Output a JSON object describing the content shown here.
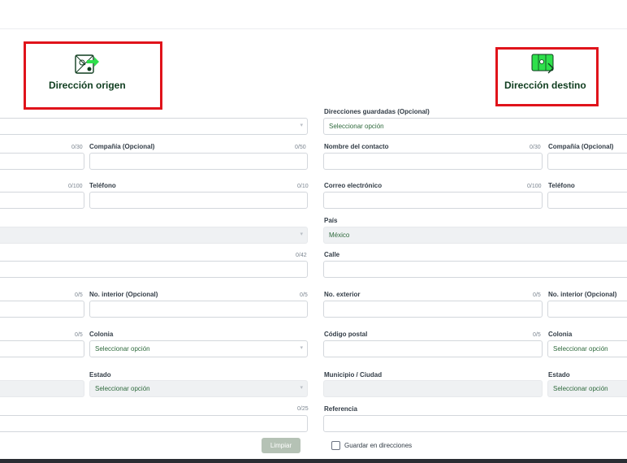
{
  "origin": {
    "title": "Dirección origen",
    "icon": "map-route-icon",
    "labels": {
      "company": "Compañía (Opcional)",
      "phone": "Teléfono",
      "interior": "No. interior (Opcional)",
      "colonia": "Colonia",
      "estado": "Estado"
    },
    "counters": {
      "name": "0/30",
      "company": "0/50",
      "email": "0/100",
      "phone": "0/10",
      "street": "0/42",
      "exterior": "0/5",
      "interior": "0/5",
      "postal": "0/5",
      "reference": "0/25"
    },
    "placeholders": {
      "colonia": "Seleccionar opción",
      "estado": "Seleccionar opción"
    },
    "clear_button": "Limpiar"
  },
  "destination": {
    "title": "Dirección destino",
    "icon": "map-arrow-icon",
    "labels": {
      "saved": "Direcciones guardadas (Opcional)",
      "contact": "Nombre del contacto",
      "company": "Compañía (Opcional)",
      "email": "Correo electrónico",
      "phone": "Teléfono",
      "country": "País",
      "street": "Calle",
      "exterior": "No. exterior",
      "interior": "No. interior (Opcional)",
      "postal": "Código postal",
      "colonia": "Colonia",
      "municipio": "Municipio / Ciudad",
      "estado": "Estado",
      "reference": "Referencia"
    },
    "counters": {
      "contact": "0/30",
      "email": "0/100",
      "exterior": "0/5",
      "postal": "0/5"
    },
    "placeholders": {
      "saved": "Seleccionar opción",
      "colonia": "Seleccionar opción",
      "estado": "Seleccionar opción"
    },
    "values": {
      "country": "México"
    },
    "save_checkbox": "Guardar en direcciones"
  },
  "colors": {
    "accent_green": "#0f3d1f",
    "highlight_red": "#e0131b",
    "icon_green": "#2ee04b"
  }
}
